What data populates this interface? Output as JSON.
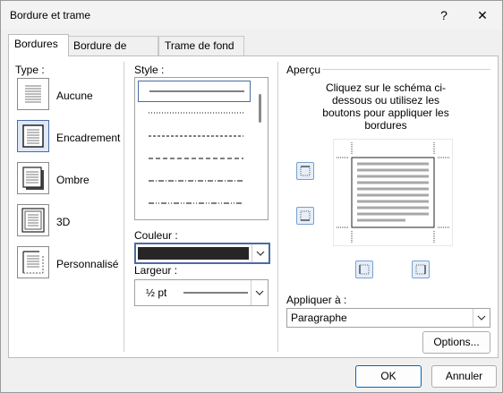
{
  "window": {
    "title": "Bordure et trame",
    "help_label": "?",
    "close_label": "✕"
  },
  "tabs": [
    {
      "label": "Bordures",
      "active": true
    },
    {
      "label": "Bordure de page",
      "active": false
    },
    {
      "label": "Trame de fond",
      "active": false
    }
  ],
  "type_section": {
    "label": "Type :",
    "options": [
      {
        "label": "Aucune",
        "selected": false,
        "icon": "none-border-icon"
      },
      {
        "label": "Encadrement",
        "selected": true,
        "icon": "box-border-icon"
      },
      {
        "label": "Ombre",
        "selected": false,
        "icon": "shadow-border-icon"
      },
      {
        "label": "3D",
        "selected": false,
        "icon": "3d-border-icon"
      },
      {
        "label": "Personnalisé",
        "selected": false,
        "icon": "custom-border-icon"
      }
    ]
  },
  "style_section": {
    "label": "Style :",
    "line_styles": [
      "solid",
      "dotted",
      "small-dashed",
      "dashed",
      "dash-dot",
      "dash-dot-dot"
    ],
    "selected_index": 0
  },
  "color_section": {
    "label": "Couleur :",
    "value_color": "#262626"
  },
  "width_section": {
    "label": "Largeur :",
    "value": "½ pt"
  },
  "preview_section": {
    "label": "Aperçu",
    "instructions": "Cliquez sur le schéma ci-dessous ou utilisez les boutons pour appliquer les bordures"
  },
  "apply_section": {
    "label": "Appliquer à :",
    "value": "Paragraphe"
  },
  "buttons": {
    "options": "Options...",
    "ok": "OK",
    "cancel": "Annuler"
  },
  "colors": {
    "accent": "#0067c0",
    "selection": "#dfe8f6"
  }
}
